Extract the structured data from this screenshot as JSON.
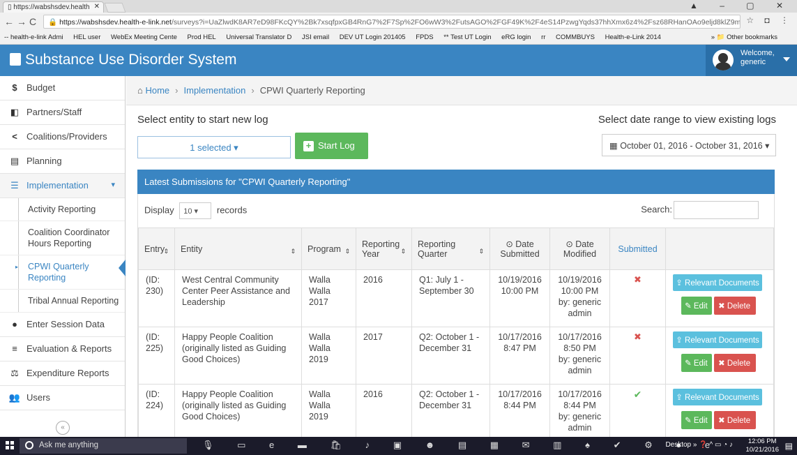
{
  "browser": {
    "tab_title": "https://wabshsdev.health",
    "url_host": "https://wabshsdev.health-e-link.net",
    "url_path": "/surveys?i=UaZlwdK8AR7eD98FKcQY%2Bk7xsqfpxGB4RnG7%2F7Sp%2FO6wW3%2FutsAGO%2FGF49K%2F4eS14PzwgYqds37hhXmx6z4%2Fsz68RHanOAo9eljd8klZ9mem7STVmznK",
    "bookmarks": [
      "-- health-e-link Admi",
      "HEL user",
      "WebEx Meeting Cente",
      "Prod HEL",
      "Universal Translator D",
      "JSI email",
      "DEV UT Login 201405",
      "FPDS",
      "** Test UT Login",
      "eRG login",
      "rr",
      "COMMBUYS",
      "Health-e-Link 2014"
    ],
    "other_bookmarks": "Other bookmarks"
  },
  "app": {
    "title": "Substance Use Disorder System",
    "welcome_line1": "Welcome,",
    "welcome_line2": "generic"
  },
  "sidebar": {
    "items": [
      {
        "label": "Budget",
        "icon": "$"
      },
      {
        "label": "Partners/Staff",
        "icon": "◧"
      },
      {
        "label": "Coalitions/Providers",
        "icon": "<"
      },
      {
        "label": "Planning",
        "icon": "▤"
      },
      {
        "label": "Implementation",
        "icon": "☰"
      }
    ],
    "subitems": [
      {
        "label": "Activity Reporting"
      },
      {
        "label": "Coalition Coordinator Hours Reporting"
      },
      {
        "label": "CPWI Quarterly Reporting"
      },
      {
        "label": "Tribal Annual Reporting"
      }
    ],
    "bottom_items": [
      {
        "label": "Enter Session Data",
        "icon": "●"
      },
      {
        "label": "Evaluation & Reports",
        "icon": "≡"
      },
      {
        "label": "Expenditure Reports",
        "icon": "⚖"
      },
      {
        "label": "Users",
        "icon": "👥"
      }
    ]
  },
  "breadcrumb": {
    "home": "Home",
    "section": "Implementation",
    "page": "CPWI Quarterly Reporting"
  },
  "new_log": {
    "heading": "Select entity to start new log",
    "select_value": "1 selected ▾",
    "start_label": "Start Log"
  },
  "existing_logs": {
    "heading": "Select date range to view existing logs",
    "date_range": "October 01, 2016 - October 31, 2016 ▾"
  },
  "panel": {
    "title": "Latest Submissions for \"CPWI Quarterly Reporting\"",
    "display_label": "Display",
    "display_value": "10",
    "records_label": "records",
    "search_label": "Search:"
  },
  "table": {
    "headers": [
      "Entry",
      "Entity",
      "Program",
      "Reporting Year",
      "Reporting Quarter",
      "⊙ Date Submitted",
      "⊙ Date Modified",
      "Submitted",
      ""
    ],
    "rows": [
      {
        "entry": "(ID: 230)",
        "entity": "West Central Community Center Peer Assistance and Leadership",
        "program": "Walla Walla 2017",
        "year": "2016",
        "quarter": "Q1: July 1 - September 30",
        "submitted_date": "10/19/2016 10:00 PM",
        "modified": "10/19/2016 10:00 PM by: generic admin",
        "submitted": "✖"
      },
      {
        "entry": "(ID: 225)",
        "entity": "Happy People Coalition (originally listed as Guiding Good Choices)",
        "program": "Walla Walla 2019",
        "year": "2017",
        "quarter": "Q2: October 1 - December 31",
        "submitted_date": "10/17/2016 8:47 PM",
        "modified": "10/17/2016 8:50 PM by: generic admin",
        "submitted": "✖"
      },
      {
        "entry": "(ID: 224)",
        "entity": "Happy People Coalition (originally listed as Guiding Good Choices)",
        "program": "Walla Walla 2019",
        "year": "2016",
        "quarter": "Q2: October 1 - December 31",
        "submitted_date": "10/17/2016 8:44 PM",
        "modified": "10/17/2016 8:44 PM by: generic admin",
        "submitted": "✔"
      }
    ],
    "doc_label": "Relevant Documents",
    "edit_label": "Edit",
    "delete_label": "Delete"
  },
  "taskbar": {
    "search_placeholder": "Ask me anything",
    "desktop_label": "Desktop",
    "time": "12:06 PM",
    "date": "10/21/2016"
  }
}
